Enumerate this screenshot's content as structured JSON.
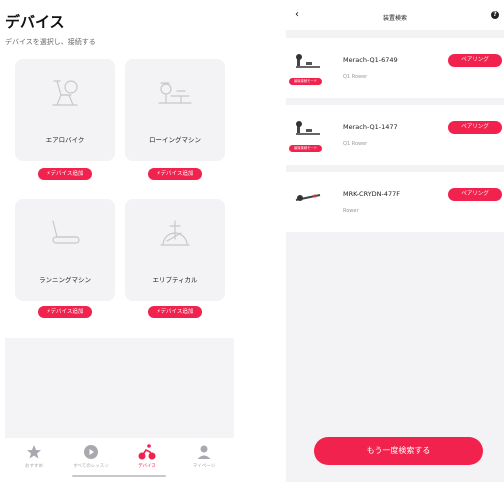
{
  "left": {
    "title": "デバイス",
    "subtitle": "デバイスを選択し、接続する",
    "cards": [
      {
        "label": "エアロバイク",
        "button": "デバイス追加",
        "icon": "exercise-bike-icon"
      },
      {
        "label": "ローイングマシン",
        "button": "デバイス追加",
        "icon": "rowing-machine-icon"
      },
      {
        "label": "ランニングマシン",
        "button": "デバイス追加",
        "icon": "treadmill-icon"
      },
      {
        "label": "エリプティカル",
        "button": "デバイス追加",
        "icon": "elliptical-icon"
      }
    ],
    "tabs": [
      {
        "label": "おすすめ",
        "icon": "star-icon"
      },
      {
        "label": "すべてのレッスン",
        "icon": "play-icon"
      },
      {
        "label": "デバイス",
        "icon": "cyclist-icon",
        "active": true
      },
      {
        "label": "マイページ",
        "icon": "person-icon"
      }
    ]
  },
  "right": {
    "title": "装置検索",
    "back_icon": "chevron-left-icon",
    "help_icon": "help-icon",
    "devices": [
      {
        "name": "Merach-Q1-6749",
        "type": "Q1 Rower",
        "badge": "最後接続モード",
        "action": "ペアリング"
      },
      {
        "name": "Merach-Q1-1477",
        "type": "Q1 Rower",
        "badge": "最後接続モード",
        "action": "ペアリング"
      },
      {
        "name": "MRK-CRYDN-477F",
        "type": "Rower",
        "badge": "",
        "action": "ペアリング"
      }
    ],
    "rescan_label": "もう一度検索する"
  },
  "colors": {
    "accent": "#f1224e",
    "card_bg": "#f3f3f5"
  }
}
